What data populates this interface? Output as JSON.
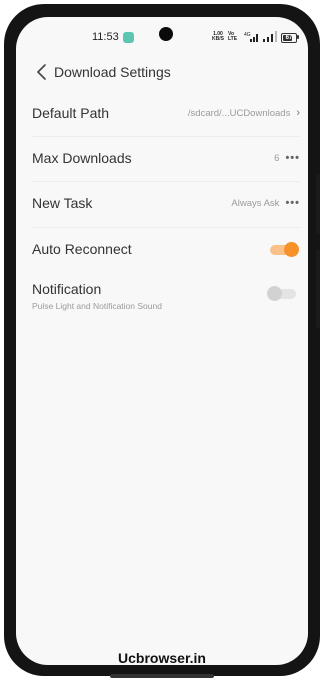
{
  "status_bar": {
    "time": "11:53",
    "net_speed_value": "1.00",
    "net_speed_unit": "KB/S",
    "volte_top": "Vo",
    "volte_bottom": "LTE",
    "net_type": "4G",
    "battery": "67"
  },
  "header": {
    "title": "Download Settings"
  },
  "settings": {
    "default_path": {
      "label": "Default Path",
      "value": "/sdcard/...UCDownloads"
    },
    "max_downloads": {
      "label": "Max Downloads",
      "value": "6"
    },
    "new_task": {
      "label": "New Task",
      "value": "Always Ask"
    },
    "auto_reconnect": {
      "label": "Auto Reconnect",
      "enabled": true
    },
    "notification": {
      "label": "Notification",
      "subtitle": "Pulse Light and Notification Sound",
      "enabled": false
    }
  },
  "watermark": "Ucbrowser.in",
  "colors": {
    "accent": "#f7922b",
    "toggle_off": "#dedede"
  }
}
